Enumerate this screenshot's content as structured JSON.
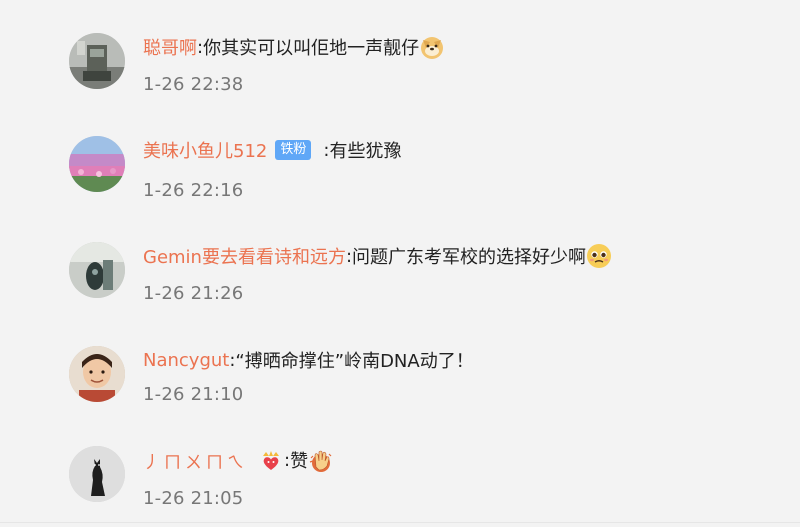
{
  "comments": [
    {
      "username": "聪哥啊",
      "separator": ":",
      "text": "你其实可以叫佢地一声靓仔",
      "emoji_icon": "doge-emoji-icon",
      "timestamp": "1-26 22:38"
    },
    {
      "username": "美味小鱼儿512",
      "badge": "铁粉",
      "separator": ":",
      "text": "有些犹豫",
      "timestamp": "1-26 22:16"
    },
    {
      "username": "Gemin要去看看诗和远方",
      "separator": ":",
      "text": "问题广东考军校的选择好少啊",
      "emoji_icon": "pleading-face-emoji-icon",
      "timestamp": "1-26 21:26"
    },
    {
      "username": "Nancygut",
      "separator": ":",
      "text": "“搏晒命撑住”岭南DNA动了！",
      "timestamp": "1-26 21:10"
    },
    {
      "username": "丿ㄇㄨㄇㄟ",
      "separator": ":",
      "text": "赞",
      "emoji_icon": "clapping-hands-emoji-icon",
      "badge_icon": "crown-heart-icon",
      "timestamp": "1-26 21:05"
    }
  ],
  "colors": {
    "background": "#f3f3f3",
    "username": "#eb7350",
    "text": "#222222",
    "timestamp": "#777777",
    "badge_bg": "#5fa7f7"
  }
}
